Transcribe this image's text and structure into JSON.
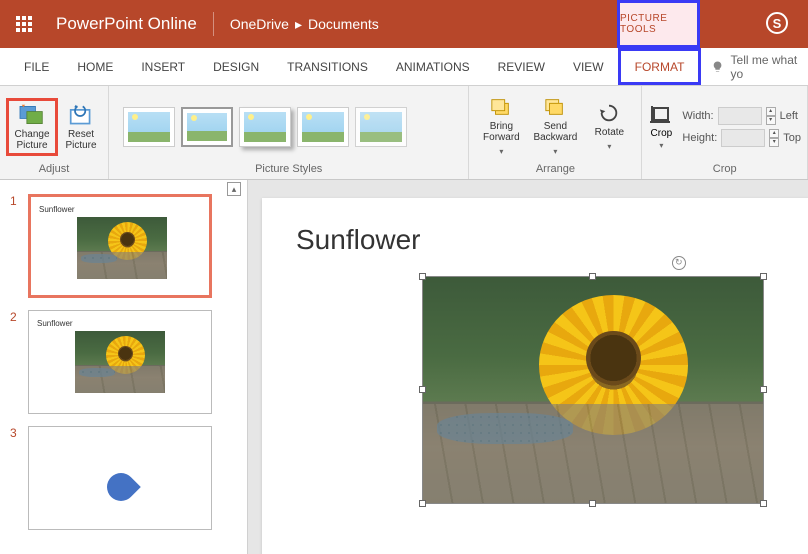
{
  "header": {
    "app_name": "PowerPoint Online",
    "breadcrumb": [
      "OneDrive",
      "Documents"
    ],
    "contextual_tab_group": "PICTURE TOOLS"
  },
  "menu": {
    "items": [
      "FILE",
      "HOME",
      "INSERT",
      "DESIGN",
      "TRANSITIONS",
      "ANIMATIONS",
      "REVIEW",
      "VIEW",
      "FORMAT"
    ],
    "active": "FORMAT",
    "tell_me": "Tell me what yo"
  },
  "ribbon": {
    "adjust": {
      "label": "Adjust",
      "change_picture": "Change Picture",
      "reset_picture": "Reset Picture"
    },
    "picture_styles": {
      "label": "Picture Styles"
    },
    "arrange": {
      "label": "Arrange",
      "bring_forward": "Bring Forward",
      "send_backward": "Send Backward",
      "rotate": "Rotate"
    },
    "crop": {
      "label": "Crop",
      "crop_btn": "Crop",
      "width_label": "Width:",
      "height_label": "Height:",
      "left_label": "Left",
      "top_label": "Top"
    }
  },
  "slides": {
    "items": [
      {
        "num": "1",
        "title": "Sunflower",
        "has_image": true,
        "selected": true
      },
      {
        "num": "2",
        "title": "Sunflower",
        "has_image": true,
        "selected": false
      },
      {
        "num": "3",
        "title": "",
        "has_shape": true,
        "selected": false
      }
    ]
  },
  "canvas": {
    "title": "Sunflower"
  }
}
